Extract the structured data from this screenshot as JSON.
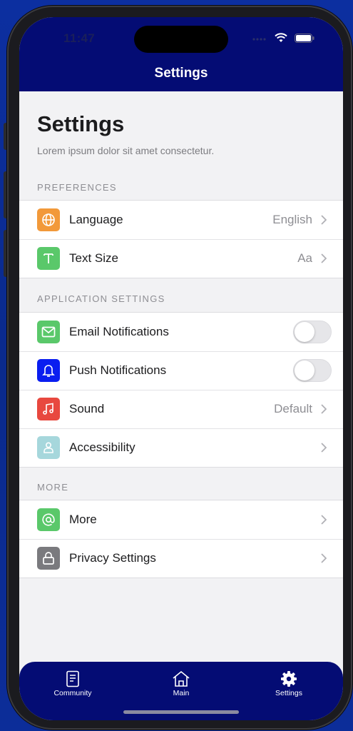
{
  "status_bar": {
    "time": "11:47"
  },
  "nav": {
    "title": "Settings"
  },
  "page": {
    "title": "Settings",
    "subtitle": "Lorem ipsum dolor sit amet consectetur."
  },
  "sections": {
    "preferences": {
      "header": "PREFERENCES",
      "items": [
        {
          "label": "Language",
          "value": "English",
          "icon": "globe-icon",
          "color": "#f2993a"
        },
        {
          "label": "Text Size",
          "value": "Aa",
          "icon": "text-size-icon",
          "color": "#5ac86a"
        }
      ]
    },
    "application": {
      "header": "APPLICATION SETTINGS",
      "items": [
        {
          "label": "Email Notifications",
          "toggle": false,
          "icon": "mail-icon",
          "color": "#5ac86a"
        },
        {
          "label": "Push Notifications",
          "toggle": false,
          "icon": "bell-icon",
          "color": "#0a1ef0"
        },
        {
          "label": "Sound",
          "value": "Default",
          "icon": "music-note-icon",
          "color": "#e8483f"
        },
        {
          "label": "Accessibility",
          "value": "",
          "icon": "person-icon",
          "color": "#a6d7dc"
        }
      ]
    },
    "more": {
      "header": "MORE",
      "items": [
        {
          "label": "More",
          "value": "",
          "icon": "at-sign-icon",
          "color": "#5ac86a"
        },
        {
          "label": "Privacy Settings",
          "value": "",
          "icon": "lock-icon",
          "color": "#7a7a7e"
        }
      ]
    }
  },
  "tabbar": {
    "tabs": [
      {
        "label": "Community",
        "icon": "document-icon"
      },
      {
        "label": "Main",
        "icon": "home-icon"
      },
      {
        "label": "Settings",
        "icon": "gear-icon",
        "selected": true
      }
    ]
  }
}
